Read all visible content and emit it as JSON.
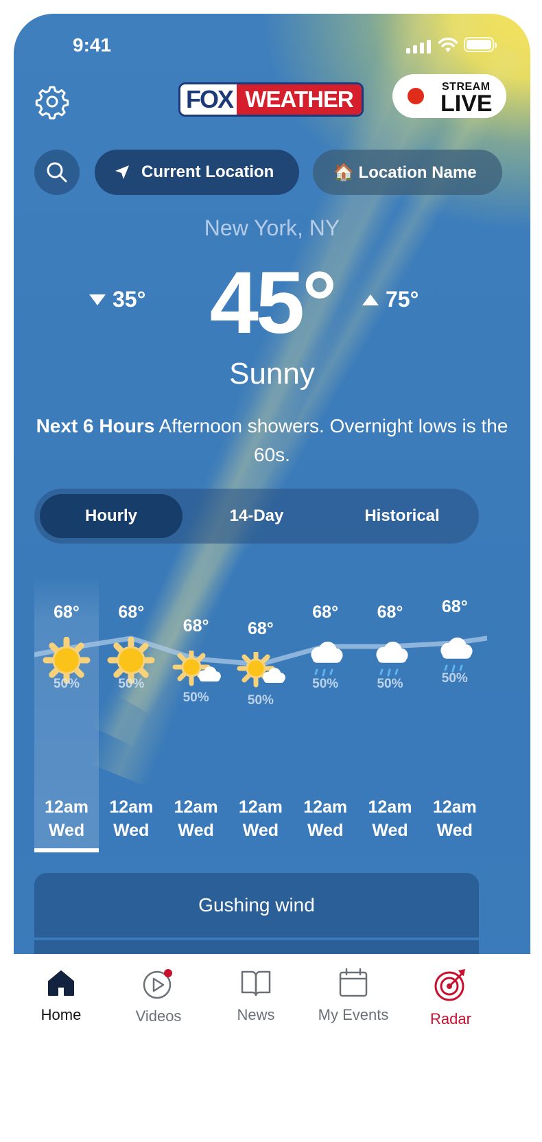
{
  "status_bar": {
    "time": "9:41"
  },
  "header": {
    "logo_left": "FOX",
    "logo_right": "WEATHER",
    "stream_small": "STREAM",
    "stream_big": "LIVE"
  },
  "location_bar": {
    "current_location": "Current Location",
    "location_name": "🏠 Location Name"
  },
  "current": {
    "city": "New York, NY",
    "temp": "45°",
    "low": "35°",
    "high": "75°",
    "condition": "Sunny",
    "next_label": "Next 6 Hours",
    "next_text": " Afternoon showers. Overnight lows is the 60s."
  },
  "tabs": [
    {
      "label": "Hourly",
      "active": true
    },
    {
      "label": "14-Day",
      "active": false
    },
    {
      "label": "Historical",
      "active": false
    }
  ],
  "hourly": [
    {
      "temp": "68°",
      "icon": "sun-icon",
      "precip": "50%",
      "time": "12am",
      "day": "Wed"
    },
    {
      "temp": "68°",
      "icon": "sun-icon",
      "precip": "50%",
      "time": "12am",
      "day": "Wed"
    },
    {
      "temp": "68°",
      "icon": "partly-cloudy-icon",
      "precip": "50%",
      "time": "12am",
      "day": "Wed"
    },
    {
      "temp": "68°",
      "icon": "partly-cloudy-icon",
      "precip": "50%",
      "time": "12am",
      "day": "Wed"
    },
    {
      "temp": "68°",
      "icon": "rain-cloud-icon",
      "precip": "50%",
      "time": "12am",
      "day": "Wed"
    },
    {
      "temp": "68°",
      "icon": "rain-cloud-icon",
      "precip": "50%",
      "time": "12am",
      "day": "Wed"
    },
    {
      "temp": "68°",
      "icon": "rain-cloud-icon",
      "precip": "50%",
      "time": "12am",
      "day": "Wed"
    }
  ],
  "wind_card": {
    "title": "Gushing wind"
  },
  "bottom_nav": [
    {
      "label": "Home"
    },
    {
      "label": "Videos"
    },
    {
      "label": "News"
    },
    {
      "label": "My Events"
    },
    {
      "label": "Radar"
    }
  ],
  "colors": {
    "accent_red": "#c8102e",
    "nav_active": "#111111",
    "brand_blue": "#1c3a7a"
  }
}
